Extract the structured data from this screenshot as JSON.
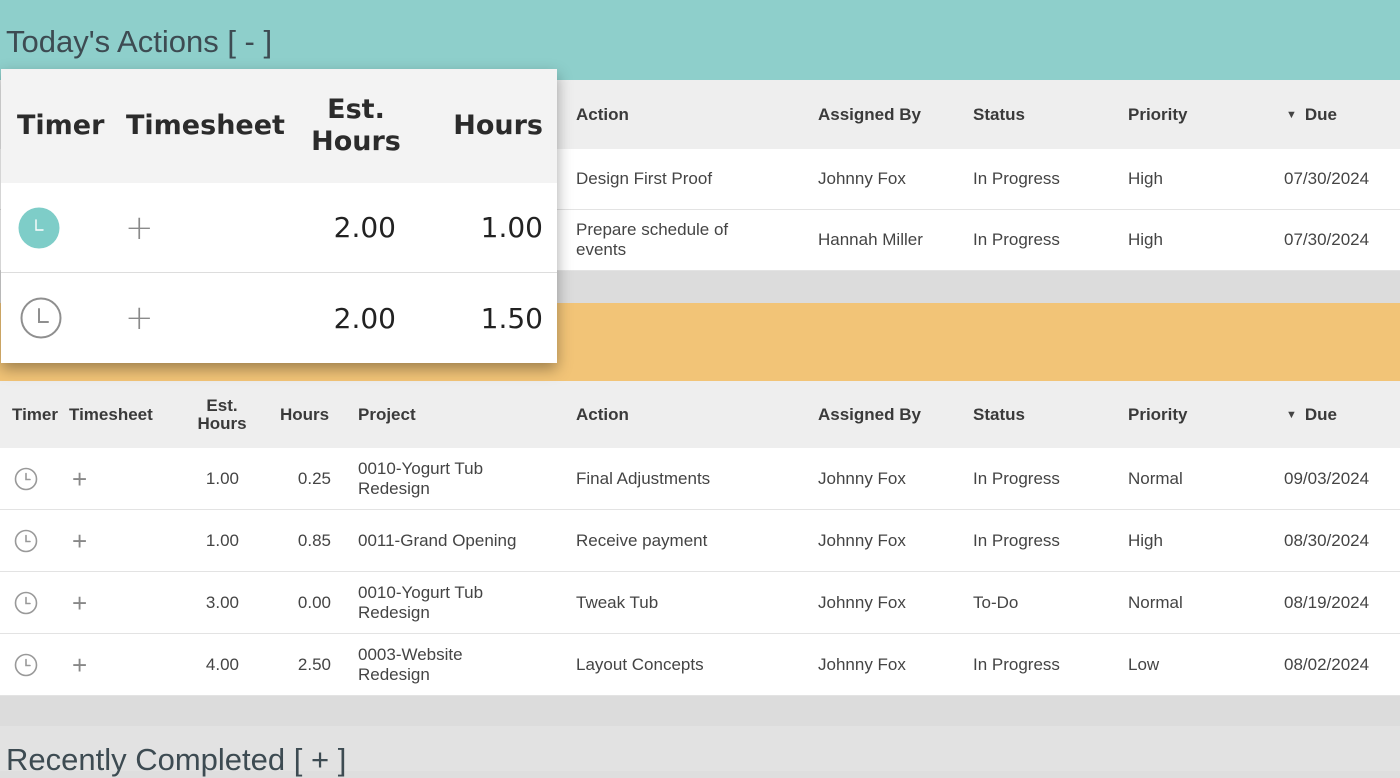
{
  "today": {
    "title": "Today's Actions [ - ]",
    "columns": {
      "timer": "Timer",
      "timesheet": "Timesheet",
      "est_hours": "Est. Hours",
      "hours": "Hours",
      "project": "Project",
      "action": "Action",
      "assigned_by": "Assigned By",
      "status": "Status",
      "priority": "Priority",
      "due": "Due"
    },
    "sort_indicator": "descending",
    "rows": [
      {
        "action": "Design First Proof",
        "assigned_by": "Johnny Fox",
        "status": "In Progress",
        "priority": "High",
        "due": "07/30/2024"
      },
      {
        "action": "Prepare schedule of events",
        "assigned_by": "Hannah Miller",
        "status": "In Progress",
        "priority": "High",
        "due": "07/30/2024"
      }
    ]
  },
  "popover": {
    "columns": {
      "timer": "Timer",
      "timesheet": "Timesheet",
      "est_hours": "Est. Hours",
      "hours": "Hours"
    },
    "rows": [
      {
        "timer_state": "running",
        "est_hours": "2.00",
        "hours": "1.00"
      },
      {
        "timer_state": "idle",
        "est_hours": "2.00",
        "hours": "1.50"
      }
    ]
  },
  "upcoming": {
    "columns": {
      "timer": "Timer",
      "timesheet": "Timesheet",
      "est_hours": "Est. Hours",
      "hours": "Hours",
      "project": "Project",
      "action": "Action",
      "assigned_by": "Assigned By",
      "status": "Status",
      "priority": "Priority",
      "due": "Due"
    },
    "rows": [
      {
        "est_hours": "1.00",
        "hours": "0.25",
        "project": "0010-Yogurt Tub Redesign",
        "action": "Final Adjustments",
        "assigned_by": "Johnny Fox",
        "status": "In Progress",
        "priority": "Normal",
        "due": "09/03/2024"
      },
      {
        "est_hours": "1.00",
        "hours": "0.85",
        "project": "0011-Grand Opening",
        "action": "Receive payment",
        "assigned_by": "Johnny Fox",
        "status": "In Progress",
        "priority": "High",
        "due": "08/30/2024"
      },
      {
        "est_hours": "3.00",
        "hours": "0.00",
        "project": "0010-Yogurt Tub Redesign",
        "action": "Tweak Tub",
        "assigned_by": "Johnny Fox",
        "status": "To-Do",
        "priority": "Normal",
        "due": "08/19/2024"
      },
      {
        "est_hours": "4.00",
        "hours": "2.50",
        "project": "0003-Website Redesign",
        "action": "Layout Concepts",
        "assigned_by": "Johnny Fox",
        "status": "In Progress",
        "priority": "Low",
        "due": "08/02/2024"
      }
    ]
  },
  "completed": {
    "title": "Recently Completed [ + ]"
  },
  "colors": {
    "today_header": "#8ecfcb",
    "orange_band": "#f2c477",
    "timer_running": "#7ecdc8",
    "grey_band": "#dcdcdc"
  },
  "icons": {
    "timer": "clock-icon",
    "timesheet": "plus-icon",
    "sort": "caret-down-icon"
  }
}
